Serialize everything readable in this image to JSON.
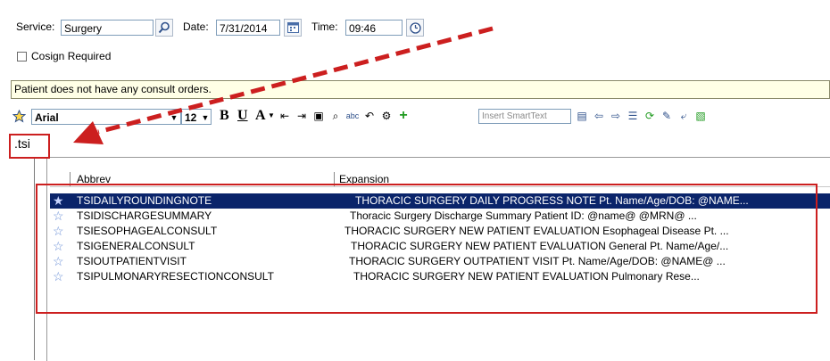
{
  "header": {
    "service_label": "Service:",
    "service_value": "Surgery",
    "date_label": "Date:",
    "date_value": "7/31/2014",
    "time_label": "Time:",
    "time_value": "09:46",
    "cosign_label": "Cosign Required"
  },
  "banner": {
    "text": "Patient does not have any consult orders."
  },
  "toolbar": {
    "font_name": "Arial",
    "font_size": "12",
    "bold": "B",
    "underline": "U",
    "color": "A",
    "smarttext_placeholder": "Insert SmartText"
  },
  "editor": {
    "text": ".tsi"
  },
  "list": {
    "col_abbrev": "Abbrev",
    "col_expansion": "Expansion",
    "rows": [
      {
        "abbrev": "TSIDAILYROUNDINGNOTE",
        "expansion": "THORACIC SURGERY DAILY PROGRESS NOTE  Pt. Name/Age/DOB:  @NAME..."
      },
      {
        "abbrev": "TSIDISCHARGESUMMARY",
        "expansion": "Thoracic Surgery Discharge Summary  Patient ID: @name@ @MRN@ ..."
      },
      {
        "abbrev": "TSIESOPHAGEALCONSULT",
        "expansion": "THORACIC SURGERY NEW PATIENT EVALUATION Esophageal Disease  Pt. ..."
      },
      {
        "abbrev": "TSIGENERALCONSULT",
        "expansion": "THORACIC SURGERY NEW PATIENT EVALUATION General  Pt. Name/Age/..."
      },
      {
        "abbrev": "TSIOUTPATIENTVISIT",
        "expansion": "THORACIC SURGERY OUTPATIENT VISIT  Pt. Name/Age/DOB:  @NAME@   ..."
      },
      {
        "abbrev": "TSIPULMONARYRESECTIONCONSULT",
        "expansion": "THORACIC SURGERY NEW PATIENT EVALUATION   Pulmonary Rese..."
      }
    ]
  },
  "colors": {
    "annotation": "#cc1f1f",
    "selection": "#0a246a",
    "banner_bg": "#ffffe6"
  },
  "icons": [
    "search-icon",
    "calendar-icon",
    "clock-icon",
    "star-icon",
    "bold-icon",
    "underline-icon",
    "font-color-icon",
    "add-icon"
  ]
}
